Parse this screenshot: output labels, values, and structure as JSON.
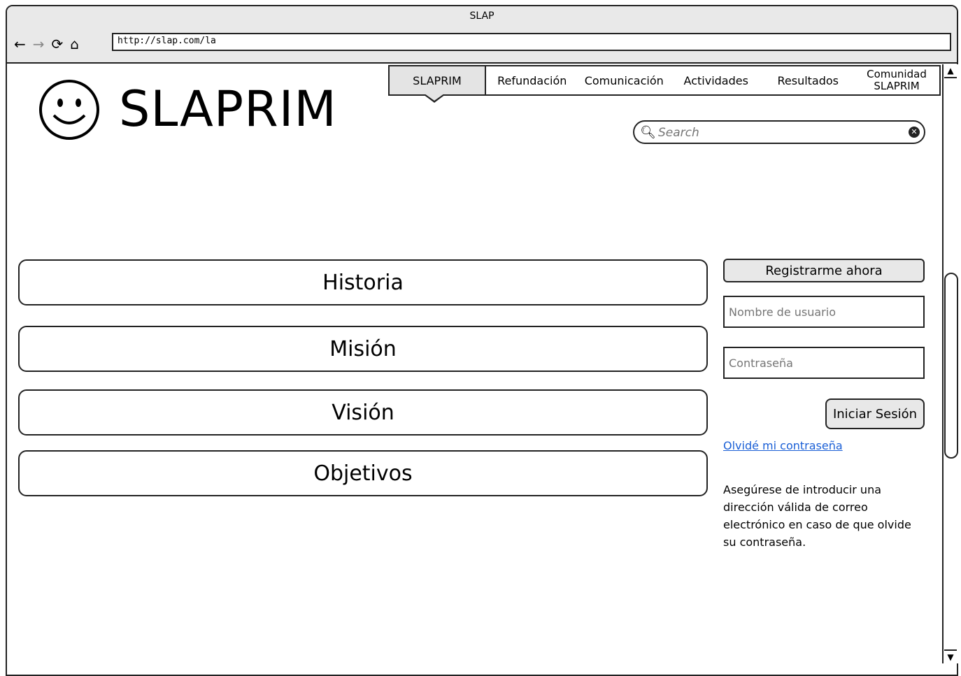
{
  "window": {
    "title": "SLAP",
    "url": "http://slap.com/la"
  },
  "toolbar": {
    "back_icon": "←",
    "forward_icon": "→",
    "reload_icon": "⟳",
    "home_icon": "⌂"
  },
  "brand": {
    "name": "SLAPRIM"
  },
  "nav": {
    "items": [
      {
        "label": "SLAPRIM"
      },
      {
        "label": "Refundación"
      },
      {
        "label": "Comunicación"
      },
      {
        "label": "Actividades"
      },
      {
        "label": "Resultados"
      },
      {
        "label": "Comunidad SLAPRIM"
      }
    ]
  },
  "search": {
    "placeholder": "Search"
  },
  "sections": [
    {
      "label": "Historia"
    },
    {
      "label": "Misión"
    },
    {
      "label": "Visión"
    },
    {
      "label": "Objetivos"
    }
  ],
  "login": {
    "register_label": "Registrarme ahora",
    "username_placeholder": "Nombre de usuario",
    "password_placeholder": "Contraseña",
    "submit_label": "Iniciar Sesión",
    "forgot_label": "Olvidé mi contraseña",
    "note": "Asegúrese de introducir una dirección válida de correo electrónico en caso de que olvide su contraseña."
  }
}
